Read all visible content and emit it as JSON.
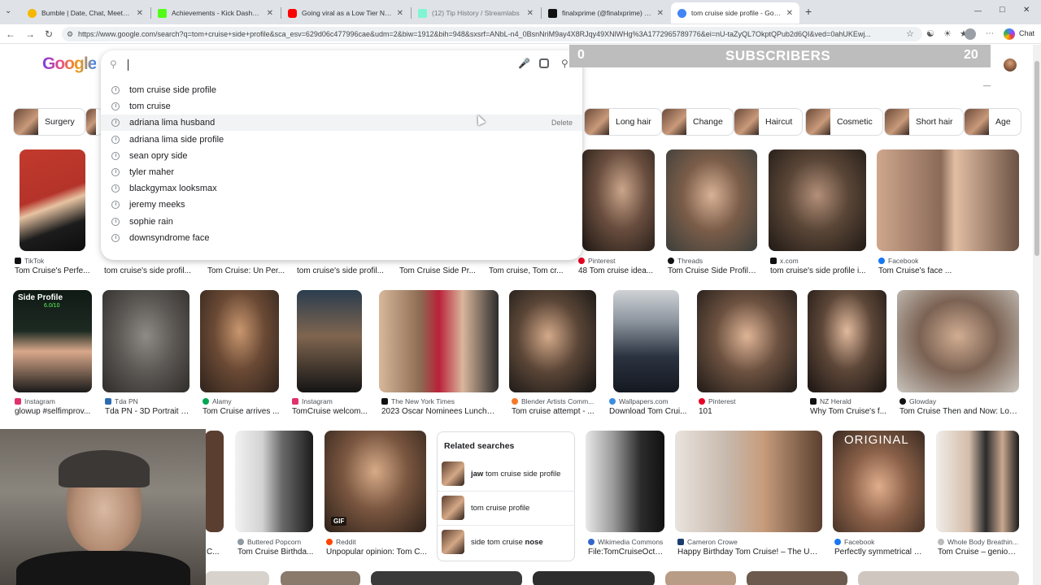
{
  "browser": {
    "tabs": [
      {
        "title": "Bumble | Date, Chat, Meet New Pe",
        "color": "#f5b800"
      },
      {
        "title": "Achievements - Kick Dashboard",
        "color": "#53fc18"
      },
      {
        "title": "Going viral as a Low Tier Normie",
        "color": "#ff0000"
      },
      {
        "title": "(12) Tip History / Streamlabs",
        "color": "#80f5d2"
      },
      {
        "title": "finalxprime (@finalxprime) | TikTok",
        "color": "#111111"
      },
      {
        "title": "tom cruise side profile - Google Se",
        "color": "#4285f4"
      }
    ],
    "new_tab": "+",
    "url": "https://www.google.com/search?q=tom+cruise+side+profile&sca_esv=629d06c477996cae&udm=2&biw=1912&bih=948&sxsrf=ANbL-n4_0BsnNriM9ay4X8RJqy49XNlWHg%3A1772965789776&ei=nU-taZyQL7OkptQPub2d6QI&ved=0ahUKEwj...",
    "chat_label": "Chat",
    "window_controls": [
      "—",
      "□",
      "✕"
    ]
  },
  "google": {
    "logo": "Google",
    "search_value": "",
    "suggestions": [
      "tom cruise side profile",
      "tom cruise",
      "adriana lima husband",
      "adriana lima side profile",
      "sean opry side",
      "tyler maher",
      "blackgymax looksmax",
      "jeremy meeks",
      "sophie rain",
      "downsyndrome face"
    ],
    "delete_label": "Delete",
    "highlighted_index": 2
  },
  "overlay": {
    "left": "0",
    "label": "SUBSCRIBERS",
    "right": "20"
  },
  "chips": [
    {
      "label": "Surgery"
    },
    {
      "label": "Long hair"
    },
    {
      "label": "Change"
    },
    {
      "label": "Haircut"
    },
    {
      "label": "Cosmetic"
    },
    {
      "label": "Short hair"
    },
    {
      "label": "Age"
    }
  ],
  "row1": [
    {
      "source": "TikTok",
      "caption": "Tom Cruise's Perfe...",
      "color": "#111111"
    },
    {
      "source": "",
      "caption": "tom cruise's side profil...",
      "color": "#999999"
    },
    {
      "source": "",
      "caption": "Tom Cruise: Un Per...",
      "color": "#999999"
    },
    {
      "source": "",
      "caption": "tom cruise's side profil...",
      "color": "#999999"
    },
    {
      "source": "",
      "caption": "Tom Cruise Side Pr...",
      "color": "#999999"
    },
    {
      "source": "",
      "caption": "Tom cruise, Tom cr...",
      "color": "#999999"
    },
    {
      "source": "Pinterest",
      "caption": "48 Tom cruise idea...",
      "color": "#e60023"
    },
    {
      "source": "Threads",
      "caption": "Tom Cruise Side Profile...",
      "color": "#111111"
    },
    {
      "source": "x.com",
      "caption": "tom cruise's side profile i...",
      "color": "#111111"
    },
    {
      "source": "Facebook",
      "caption": "Tom Cruise's face ...",
      "color": "#1877f2"
    }
  ],
  "row2": [
    {
      "source": "Instagram",
      "caption": "glowup #selfimprov...",
      "color": "#e1306c",
      "overlay": "Side Profile",
      "score": "6.0/10"
    },
    {
      "source": "Tda PN",
      "caption": "Tda PN - 3D Portrait o...",
      "color": "#2b6cb0"
    },
    {
      "source": "Alamy",
      "caption": "Tom Cruise arrives ...",
      "color": "#00a651"
    },
    {
      "source": "Instagram",
      "caption": "TomCruise welcom...",
      "color": "#e1306c"
    },
    {
      "source": "The New York Times",
      "caption": "2023 Oscar Nominees Luncheo...",
      "color": "#111111"
    },
    {
      "source": "Blender Artists Comm...",
      "caption": "Tom cruise attempt - ...",
      "color": "#f5792a"
    },
    {
      "source": "Wallpapers.com",
      "caption": "Download Tom Crui...",
      "color": "#3c8dde"
    },
    {
      "source": "Pinterest",
      "caption": "101",
      "color": "#e60023"
    },
    {
      "source": "NZ Herald",
      "caption": "Why Tom Cruise's f...",
      "color": "#111111"
    },
    {
      "source": "Glowday",
      "caption": "Tom Cruise Then and Now: Loo...",
      "color": "#111111"
    }
  ],
  "row3": [
    {
      "source": "",
      "caption": "C...",
      "color": "#999999"
    },
    {
      "source": "Buttered Popcorn",
      "caption": "Tom Cruise Birthda...",
      "color": "#999999"
    },
    {
      "source": "Reddit",
      "caption": "Unpopular opinion: Tom C...",
      "color": "#ff4500",
      "tag": "GIF"
    },
    {
      "source": "Wikimedia Commons",
      "caption": "File:TomCruiseOct0...",
      "color": "#3366cc"
    },
    {
      "source": "Cameron Crowe",
      "caption": "Happy Birthday Tom Cruise! – The Unc...",
      "color": "#1a3d6d"
    },
    {
      "source": "Facebook",
      "caption": "Perfectly symmetrical T...",
      "color": "#1877f2",
      "overlay": "ORIGINAL"
    },
    {
      "source": "Whole Body Breathin...",
      "caption": "Tom Cruise – geniop...",
      "color": "#999999"
    }
  ],
  "related": {
    "title": "Related searches",
    "items": [
      {
        "bold": "jaw",
        "text": " tom cruise side profile"
      },
      {
        "bold": "",
        "text": "tom cruise profile"
      },
      {
        "bold": "nose",
        "text": "side tom cruise "
      }
    ]
  }
}
